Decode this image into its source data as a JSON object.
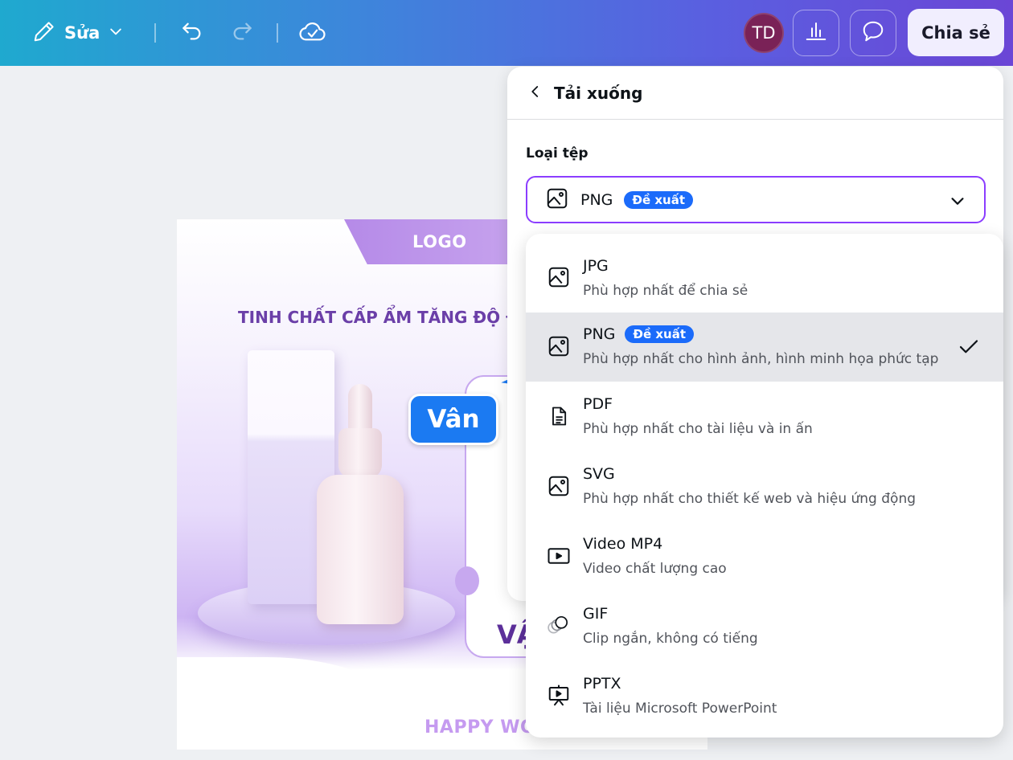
{
  "toolbar": {
    "edit_label": "Sửa",
    "avatar_initials": "TD",
    "share_label": "Chia sẻ"
  },
  "design": {
    "logo_text": "LOGO",
    "headline": "TINH CHẤT CẤP ẨM TĂNG ĐỘ Đ",
    "card_text": "VẬ",
    "footer_text": "HAPPY WO"
  },
  "collaborator": {
    "name": "Vân",
    "color": "#1b7af2"
  },
  "download_panel": {
    "title": "Tải xuống",
    "file_type_label": "Loại tệp",
    "selected_value": "PNG",
    "selected_badge": "Đề xuất",
    "options": [
      {
        "name": "JPG",
        "badge": "",
        "desc": "Phù hợp nhất để chia sẻ",
        "icon": "image-icon",
        "selected": false
      },
      {
        "name": "PNG",
        "badge": "Đề xuất",
        "desc": "Phù hợp nhất cho hình ảnh, hình minh họa phức tạp",
        "icon": "image-icon",
        "selected": true
      },
      {
        "name": "PDF",
        "badge": "",
        "desc": "Phù hợp nhất cho tài liệu và in ấn",
        "icon": "document-icon",
        "selected": false
      },
      {
        "name": "SVG",
        "badge": "",
        "desc": "Phù hợp nhất cho thiết kế web và hiệu ứng động",
        "icon": "image-icon",
        "selected": false
      },
      {
        "name": "Video MP4",
        "badge": "",
        "desc": "Video chất lượng cao",
        "icon": "video-icon",
        "selected": false
      },
      {
        "name": "GIF",
        "badge": "",
        "desc": "Clip ngắn, không có tiếng",
        "icon": "gif-icon",
        "selected": false
      },
      {
        "name": "PPTX",
        "badge": "",
        "desc": "Tài liệu Microsoft PowerPoint",
        "icon": "presentation-icon",
        "selected": false
      }
    ]
  },
  "colors": {
    "accent": "#8b3dff",
    "badge": "#1b6bfa"
  }
}
